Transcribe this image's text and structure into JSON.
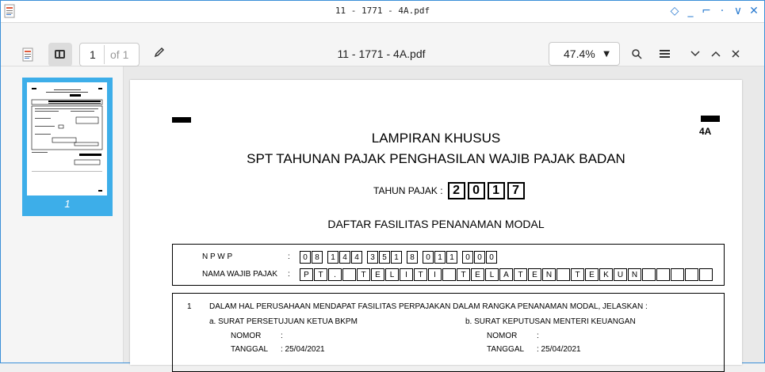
{
  "window": {
    "title": "11 - 1771 - 4A.pdf",
    "controls": [
      "◇",
      "_",
      "⌐",
      "·",
      "∨",
      "✕"
    ]
  },
  "toolbar": {
    "page_current": "1",
    "page_of": "of 1",
    "doc_title": "11 - 1771 - 4A.pdf",
    "zoom": "47.4%"
  },
  "sidebar": {
    "thumbnail_label": "1"
  },
  "document": {
    "form_code": "4A",
    "title_line1": "LAMPIRAN KHUSUS",
    "title_line2": "SPT TAHUNAN PAJAK PENGHASILAN WAJIB PAJAK BADAN",
    "tahun_label": "TAHUN PAJAK :",
    "tahun_digits": [
      "2",
      "0",
      "1",
      "7"
    ],
    "subheading": "DAFTAR FASILITAS PENANAMAN MODAL",
    "npwp_label": "N P W P",
    "npwp_groups": [
      [
        "0",
        "8"
      ],
      [
        "1",
        "4",
        "4"
      ],
      [
        "3",
        "5",
        "1"
      ],
      [
        "8"
      ],
      [
        "0",
        "1",
        "1"
      ],
      [
        "0",
        "0",
        "0"
      ]
    ],
    "nama_label": "NAMA WAJIB PAJAK",
    "nama_cells": [
      "P",
      "T",
      ".",
      "",
      "T",
      "E",
      "L",
      "I",
      "T",
      "I",
      "",
      "T",
      "E",
      "L",
      "A",
      "T",
      "E",
      "N",
      "",
      "T",
      "E",
      "K",
      "U",
      "N",
      "",
      "",
      "",
      "",
      ""
    ],
    "colon": ":",
    "section1": {
      "number": "1",
      "question": "DALAM HAL PERUSAHAAN MENDAPAT FASILITAS PERPAJAKAN DALAM RANGKA PENANAMAN MODAL, JELASKAN :",
      "a_label": "a.   SURAT PERSETUJUAN KETUA BKPM",
      "b_label": "b.   SURAT KEPUTUSAN MENTERI KEUANGAN",
      "nomor_label": "NOMOR",
      "nomor_colon": ":",
      "tanggal_label": "TANGGAL",
      "tanggal_a": ":  25/04/2021",
      "tanggal_b": ":  25/04/2021"
    }
  }
}
